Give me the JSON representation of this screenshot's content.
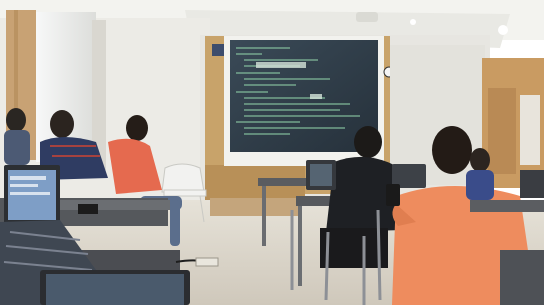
{
  "scene": {
    "kind": "photo",
    "subject": "classroom-workshop",
    "colors": {
      "wall": "#ECEBE5",
      "ceiling": "#F4F4F0",
      "wood_panel": "#C9A368",
      "screen": "#2E3A45",
      "screen_text": "#8FD0A8",
      "floor": "#D8D3C8",
      "desk": "#5C5E62",
      "orange_shirt": "#EE8A5E",
      "red_shirt": "#E7684E",
      "dark_shirt": "#1E2024"
    }
  }
}
